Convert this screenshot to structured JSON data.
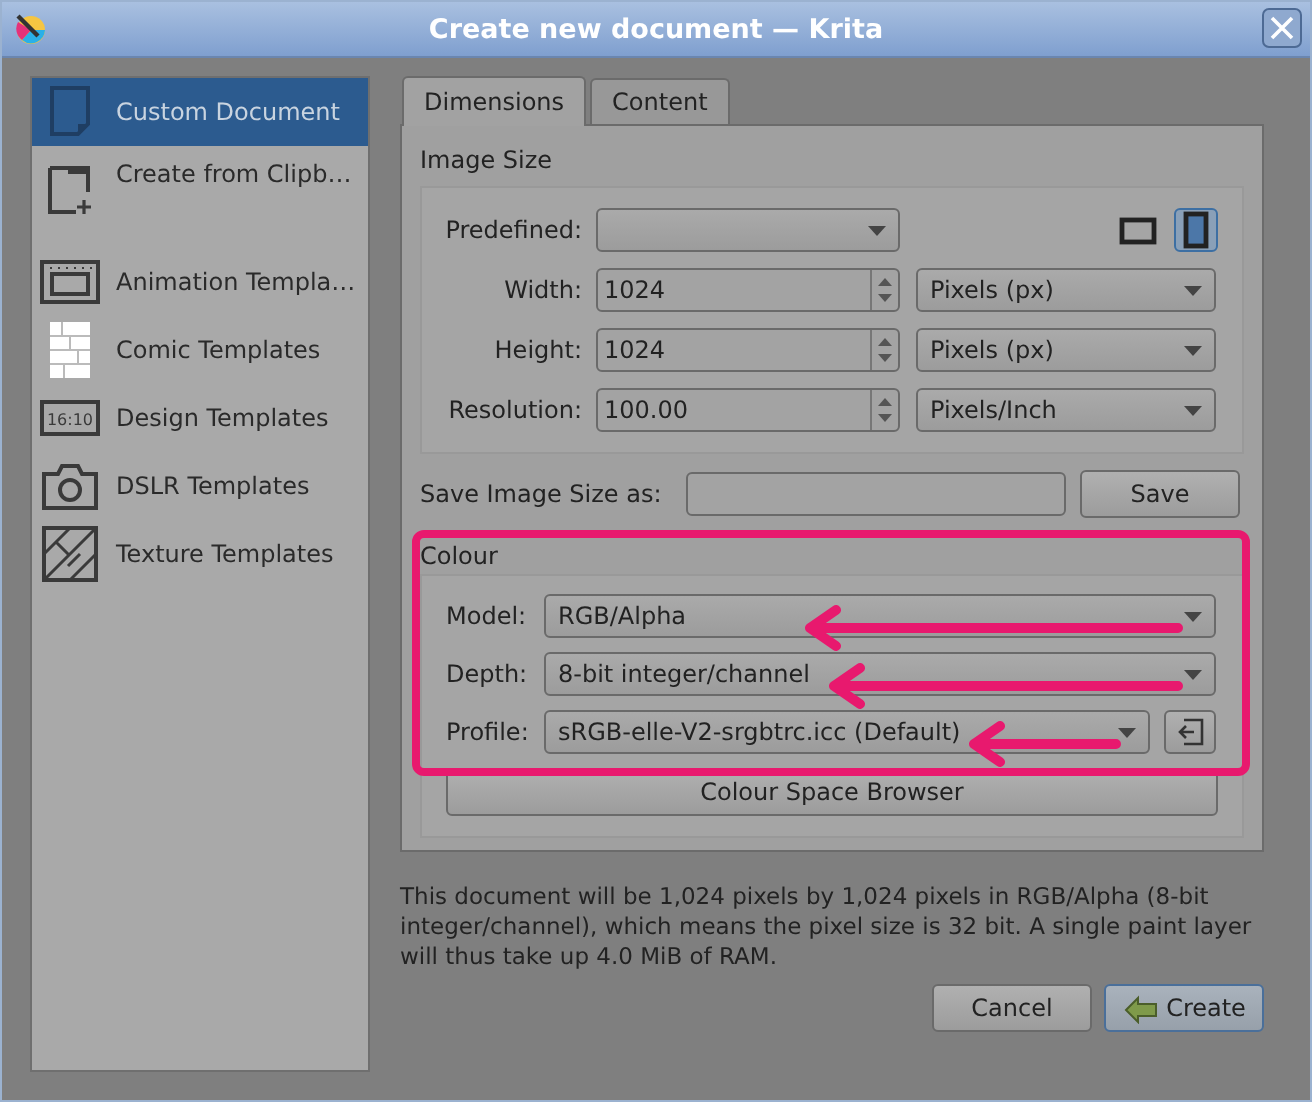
{
  "window": {
    "title": "Create new document — Krita"
  },
  "sidebar": {
    "items": [
      {
        "kind": "custom",
        "label": "Custom Document",
        "selected": true
      },
      {
        "kind": "clipboard",
        "label": "Create from Clipb…",
        "selected": false
      },
      {
        "kind": "animation",
        "label": "Animation Templa…",
        "selected": false
      },
      {
        "kind": "comic",
        "label": "Comic Templates",
        "selected": false
      },
      {
        "kind": "design",
        "label": "Design Templates",
        "selected": false,
        "icon_text": "16:10"
      },
      {
        "kind": "dslr",
        "label": "DSLR Templates",
        "selected": false
      },
      {
        "kind": "texture",
        "label": "Texture Templates",
        "selected": false
      }
    ]
  },
  "tabs": [
    {
      "label": "Dimensions",
      "selected": true
    },
    {
      "label": "Content",
      "selected": false
    }
  ],
  "image_size": {
    "title": "Image Size",
    "predefined_label": "Predefined:",
    "orientation_buttons": [
      {
        "kind": "landscape",
        "selected": false
      },
      {
        "kind": "portrait",
        "selected": true
      }
    ],
    "fields": [
      {
        "label": "Width:",
        "value": "1024",
        "unit": "Pixels (px)"
      },
      {
        "label": "Height:",
        "value": "1024",
        "unit": "Pixels (px)"
      },
      {
        "label": "Resolution:",
        "value": "100.00",
        "unit": "Pixels/Inch"
      }
    ]
  },
  "save_size": {
    "label": "Save Image Size as:",
    "button": "Save"
  },
  "colour": {
    "title": "Colour",
    "rows": [
      {
        "label": "Model:",
        "value": "RGB/Alpha"
      },
      {
        "label": "Depth:",
        "value": "8-bit integer/channel"
      },
      {
        "label": "Profile:",
        "value": "sRGB-elle-V2-srgbtrc.icc (Default)"
      }
    ],
    "browser_button": "Colour Space Browser"
  },
  "summary": "This document will be 1,024 pixels by 1,024 pixels in RGB/Alpha (8-bit integer/channel), which means the pixel size is 32 bit. A single paint layer will thus take up 4.0 MiB of RAM.",
  "buttons": [
    {
      "label": "Cancel",
      "kind": "cancel"
    },
    {
      "label": "Create",
      "kind": "create"
    }
  ]
}
